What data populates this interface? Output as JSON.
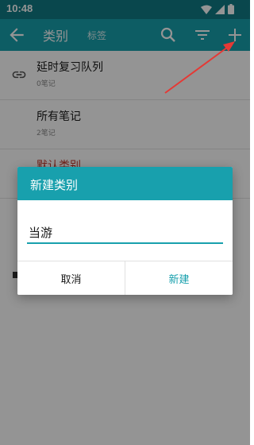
{
  "status_bar": {
    "time": "10:48"
  },
  "app_bar": {
    "title": "类别",
    "subtitle": "标签",
    "icons": [
      "back-arrow-icon",
      "search-icon",
      "filter-icon",
      "plus-icon"
    ]
  },
  "list": {
    "items": [
      {
        "title": "延时复习队列",
        "subtitle": "0笔记",
        "icon": "link-icon"
      },
      {
        "title": "所有笔记",
        "subtitle": "2笔记"
      },
      {
        "title": "默认类别",
        "subtitle": ""
      }
    ]
  },
  "dialog": {
    "title": "新建类别",
    "input_value": "当游",
    "cancel_label": "取消",
    "create_label": "新建"
  },
  "colors": {
    "primary": "#17a0ad",
    "status_bar": "#107a85",
    "arrow": "#e53935"
  }
}
